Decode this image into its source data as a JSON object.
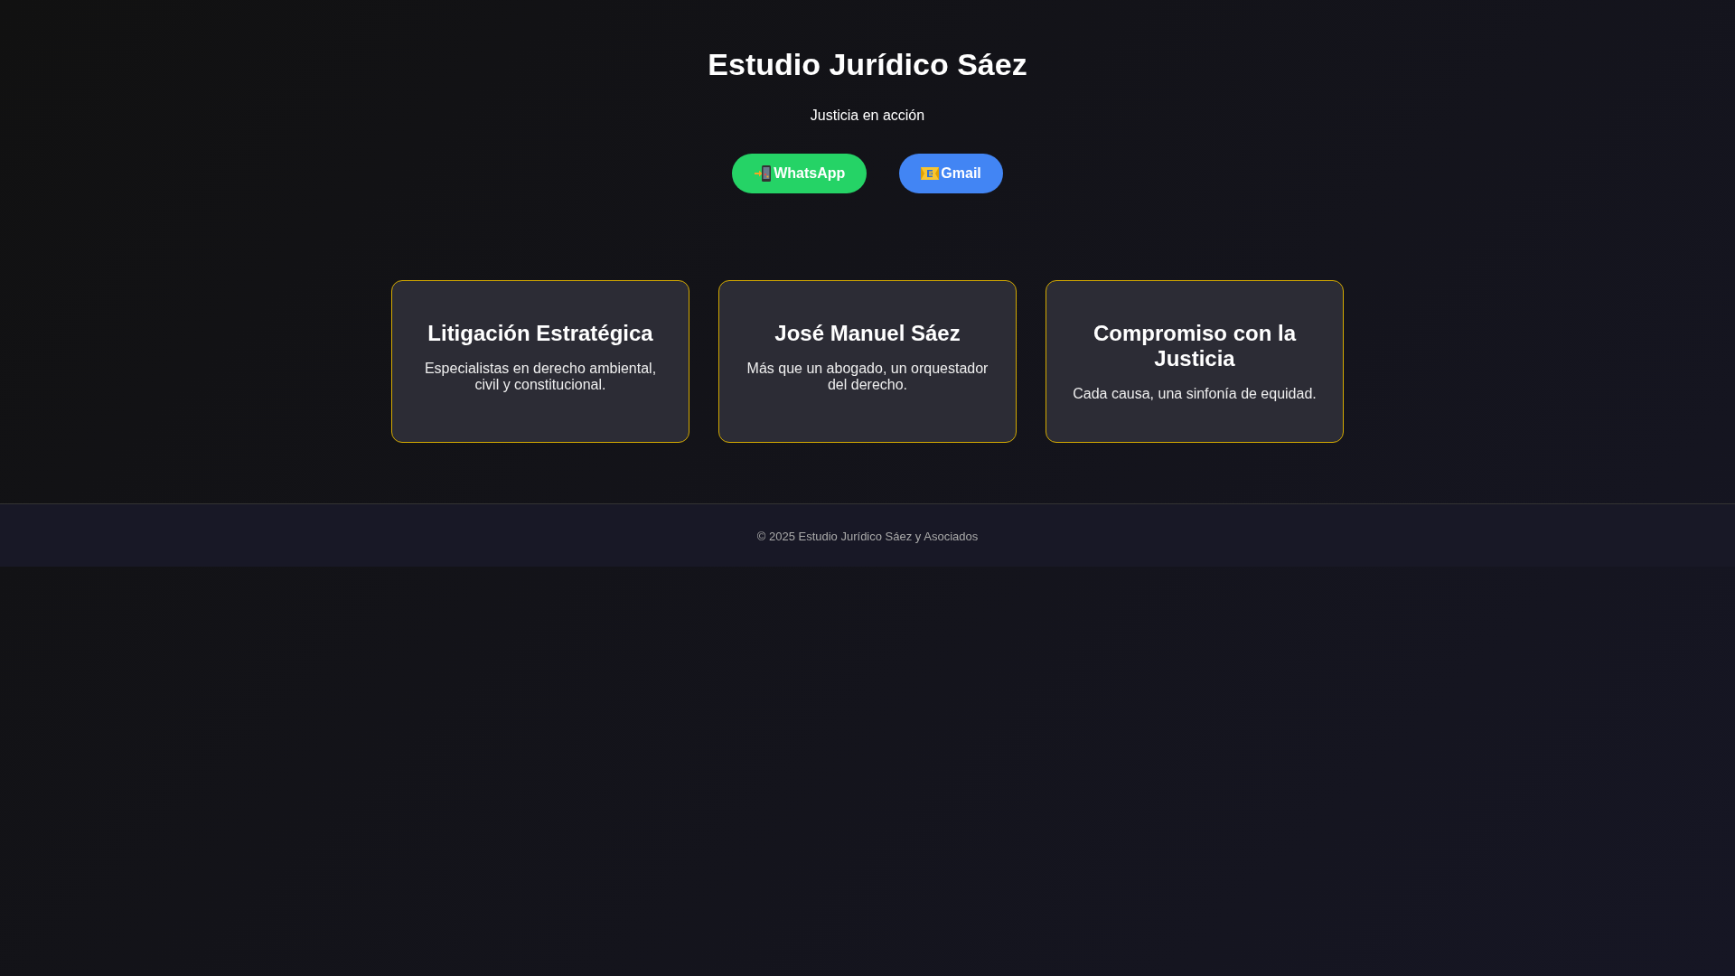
{
  "header": {
    "title": "Estudio Jurídico Sáez",
    "tagline": "Justicia en acción"
  },
  "buttons": [
    {
      "kind": "whatsapp",
      "label": "WhatsApp"
    },
    {
      "kind": "gmail",
      "label": "Gmail"
    }
  ],
  "cards": [
    {
      "title": "Litigación Estratégica",
      "text": "Especialistas en derecho ambiental, civil y constitucional."
    },
    {
      "title": "José Manuel Sáez",
      "text": "Más que un abogado, un orquestador del derecho."
    },
    {
      "title": "Compromiso con la Justicia",
      "text": "Cada causa, una sinfonía de equidad."
    }
  ],
  "footer": {
    "text": "© 2025 Estudio Jurídico Sáez y Asociados"
  }
}
